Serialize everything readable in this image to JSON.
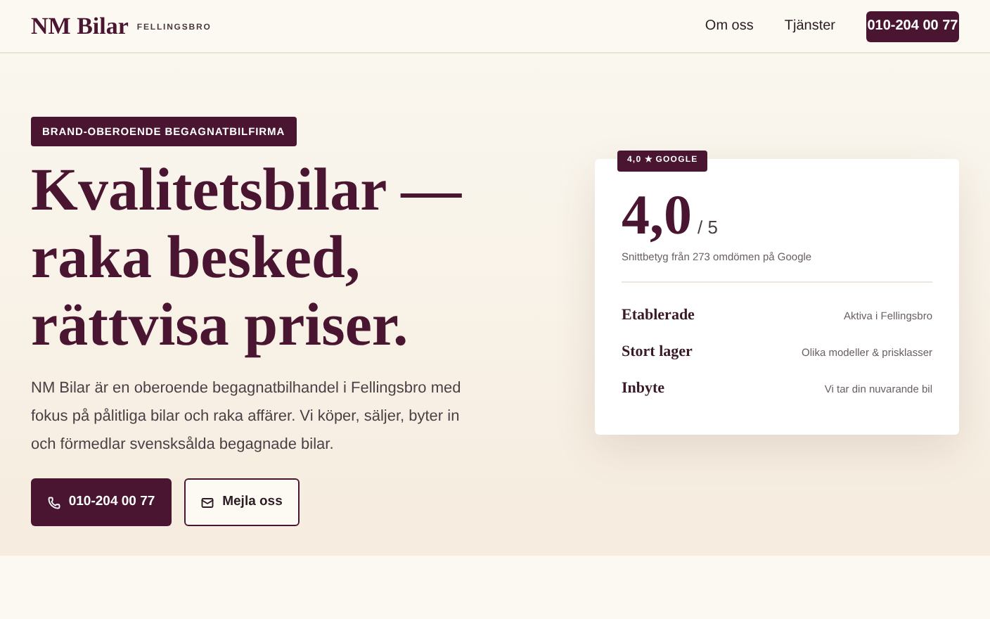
{
  "header": {
    "brand": "NM Bilar",
    "location": "FELLINGSBRO",
    "nav": [
      "Om oss",
      "Tjänster"
    ],
    "phone_button": "010-204 00 77"
  },
  "hero": {
    "badge": "BRAND-OBEROENDE BEGAGNATBILFIRMA",
    "headline": "Kvalitetsbilar — raka besked, rättvisa priser.",
    "description": "NM Bilar är en oberoende begagnatbilhandel i Fellingsbro med fokus på pålitliga bilar och raka affärer. Vi köper, säljer, byter in och förmedlar svensksålda begagnade bilar.",
    "buttons": [
      {
        "kind": "phone",
        "label": "010-204 00 77"
      },
      {
        "kind": "email",
        "label": "Mejla oss"
      }
    ]
  },
  "rating_card": {
    "badge": "4,0 ★ GOOGLE",
    "score": "4,0",
    "scale": "/ 5",
    "caption": "Snittbetyg från 273 omdömen på Google",
    "facts": [
      {
        "label": "Etablerade",
        "value": "Aktiva i Fellingsbro"
      },
      {
        "label": "Stort lager",
        "value": "Olika modeller & prisklasser"
      },
      {
        "label": "Inbyte",
        "value": "Vi tar din nuvarande bil"
      }
    ]
  }
}
